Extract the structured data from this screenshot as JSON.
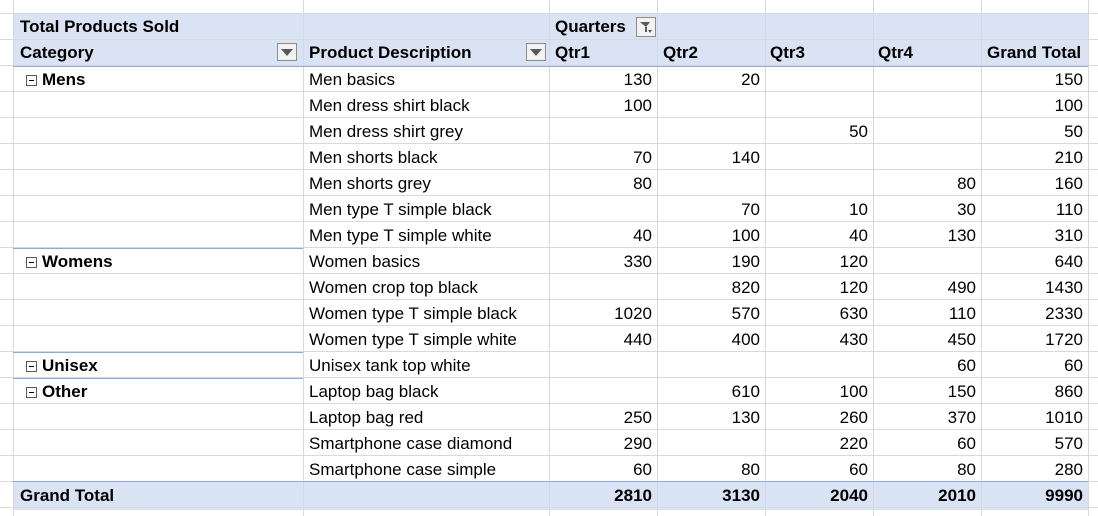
{
  "pivot": {
    "title": "Total Products Sold",
    "column_field": "Quarters",
    "row_header_category": "Category",
    "row_header_product": "Product Description",
    "column_headers": [
      "Qtr1",
      "Qtr2",
      "Qtr3",
      "Qtr4",
      "Grand Total"
    ],
    "rows": [
      {
        "category": "Mens",
        "product": "Men basics",
        "q1": "130",
        "q2": "20",
        "q3": "",
        "q4": "",
        "total": "150"
      },
      {
        "category": "",
        "product": "Men dress shirt black",
        "q1": "100",
        "q2": "",
        "q3": "",
        "q4": "",
        "total": "100"
      },
      {
        "category": "",
        "product": "Men dress shirt grey",
        "q1": "",
        "q2": "",
        "q3": "50",
        "q4": "",
        "total": "50"
      },
      {
        "category": "",
        "product": "Men shorts black",
        "q1": "70",
        "q2": "140",
        "q3": "",
        "q4": "",
        "total": "210"
      },
      {
        "category": "",
        "product": "Men shorts grey",
        "q1": "80",
        "q2": "",
        "q3": "",
        "q4": "80",
        "total": "160"
      },
      {
        "category": "",
        "product": "Men type T simple black",
        "q1": "",
        "q2": "70",
        "q3": "10",
        "q4": "30",
        "total": "110"
      },
      {
        "category": "",
        "product": "Men type T simple white",
        "q1": "40",
        "q2": "100",
        "q3": "40",
        "q4": "130",
        "total": "310"
      },
      {
        "category": "Womens",
        "product": "Women basics",
        "q1": "330",
        "q2": "190",
        "q3": "120",
        "q4": "",
        "total": "640"
      },
      {
        "category": "",
        "product": "Women crop top black",
        "q1": "",
        "q2": "820",
        "q3": "120",
        "q4": "490",
        "total": "1430"
      },
      {
        "category": "",
        "product": "Women type T simple black",
        "q1": "1020",
        "q2": "570",
        "q3": "630",
        "q4": "110",
        "total": "2330"
      },
      {
        "category": "",
        "product": "Women type T simple white",
        "q1": "440",
        "q2": "400",
        "q3": "430",
        "q4": "450",
        "total": "1720"
      },
      {
        "category": "Unisex",
        "product": "Unisex tank top white",
        "q1": "",
        "q2": "",
        "q3": "",
        "q4": "60",
        "total": "60"
      },
      {
        "category": "Other",
        "product": "Laptop bag black",
        "q1": "",
        "q2": "610",
        "q3": "100",
        "q4": "150",
        "total": "860"
      },
      {
        "category": "",
        "product": "Laptop bag red",
        "q1": "250",
        "q2": "130",
        "q3": "260",
        "q4": "370",
        "total": "1010"
      },
      {
        "category": "",
        "product": "Smartphone case diamond",
        "q1": "290",
        "q2": "",
        "q3": "220",
        "q4": "60",
        "total": "570"
      },
      {
        "category": "",
        "product": "Smartphone case simple",
        "q1": "60",
        "q2": "80",
        "q3": "60",
        "q4": "80",
        "total": "280"
      }
    ],
    "grand_total": {
      "label": "Grand Total",
      "q1": "2810",
      "q2": "3130",
      "q3": "2040",
      "q4": "2010",
      "total": "9990"
    },
    "colors": {
      "header_fill": "#dae3f3",
      "separator": "#8eaadb",
      "gridline": "#d9d9d9"
    },
    "icons": {
      "dropdown": "dropdown-arrow-icon",
      "filter": "filter-icon",
      "collapse": "collapse-minus-icon"
    }
  }
}
